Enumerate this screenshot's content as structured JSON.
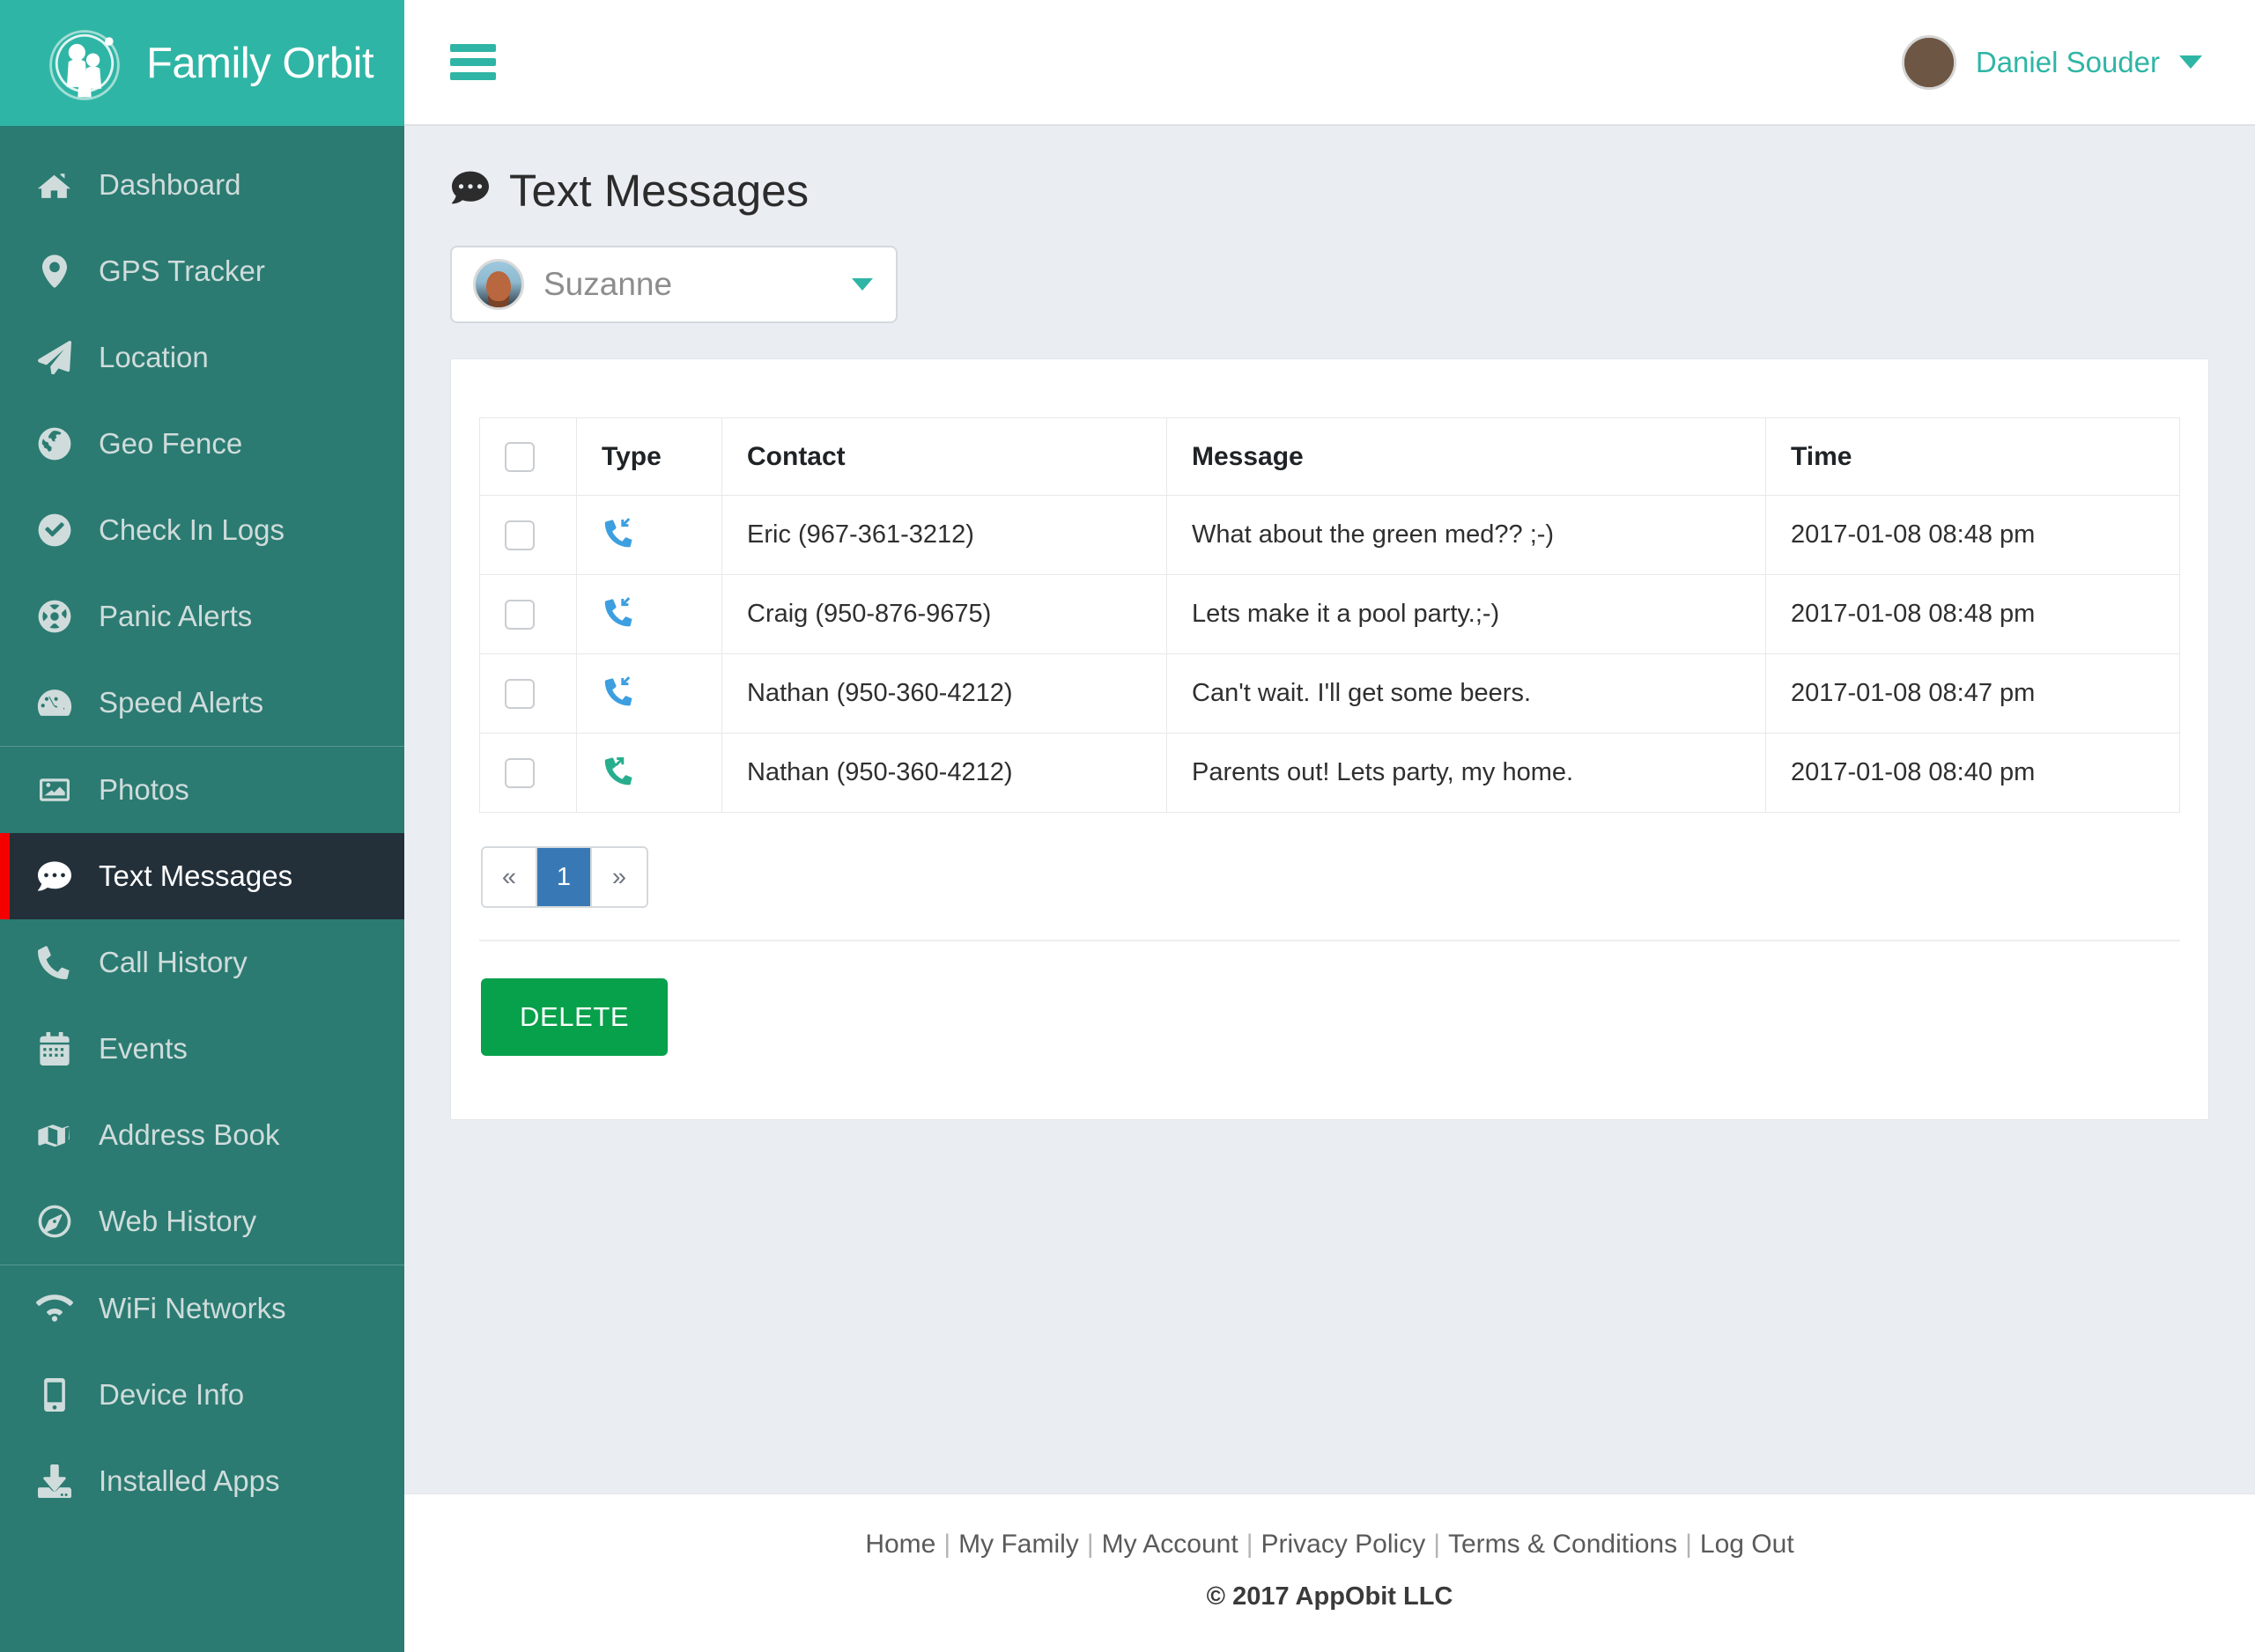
{
  "brand": {
    "name": "Family Orbit",
    "logo_icon": "family-orbit-logo"
  },
  "topbar": {
    "menu_toggle_icon": "hamburger-icon",
    "user_name": "Daniel Souder",
    "user_avatar_icon": "user-avatar",
    "user_caret_icon": "chevron-down-icon"
  },
  "sidebar": {
    "items": [
      {
        "label": "Dashboard",
        "icon": "home-icon",
        "active": false,
        "divider_after": false
      },
      {
        "label": "GPS Tracker",
        "icon": "map-pin-icon",
        "active": false,
        "divider_after": false
      },
      {
        "label": "Location",
        "icon": "paper-plane-icon",
        "active": false,
        "divider_after": false
      },
      {
        "label": "Geo Fence",
        "icon": "globe-icon",
        "active": false,
        "divider_after": false
      },
      {
        "label": "Check In Logs",
        "icon": "check-circle-icon",
        "active": false,
        "divider_after": false
      },
      {
        "label": "Panic Alerts",
        "icon": "life-ring-icon",
        "active": false,
        "divider_after": false
      },
      {
        "label": "Speed Alerts",
        "icon": "tachometer-icon",
        "active": false,
        "divider_after": true
      },
      {
        "label": "Photos",
        "icon": "image-icon",
        "active": false,
        "divider_after": false
      },
      {
        "label": "Text Messages",
        "icon": "comment-dots-icon",
        "active": true,
        "divider_after": false
      },
      {
        "label": "Call History",
        "icon": "phone-icon",
        "active": false,
        "divider_after": false
      },
      {
        "label": "Events",
        "icon": "calendar-icon",
        "active": false,
        "divider_after": false
      },
      {
        "label": "Address Book",
        "icon": "book-icon",
        "active": false,
        "divider_after": false
      },
      {
        "label": "Web History",
        "icon": "compass-icon",
        "active": false,
        "divider_after": true
      },
      {
        "label": "WiFi Networks",
        "icon": "wifi-icon",
        "active": false,
        "divider_after": false
      },
      {
        "label": "Device Info",
        "icon": "mobile-icon",
        "active": false,
        "divider_after": false
      },
      {
        "label": "Installed Apps",
        "icon": "download-icon",
        "active": false,
        "divider_after": false
      }
    ]
  },
  "page": {
    "title": "Text Messages",
    "title_icon": "comment-dots-icon"
  },
  "child_selector": {
    "selected": "Suzanne",
    "avatar_icon": "child-avatar",
    "caret_icon": "caret-down-icon"
  },
  "table": {
    "select_all_icon": "checkbox-unchecked",
    "columns": [
      "",
      "Type",
      "Contact",
      "Message",
      "Time"
    ],
    "rows": [
      {
        "checkbox_icon": "checkbox-unchecked",
        "type": "incoming",
        "type_icon": "phone-incoming-icon",
        "contact": "Eric (967-361-3212)",
        "message": "What about the green med?? ;-)",
        "time": "2017-01-08 08:48 pm"
      },
      {
        "checkbox_icon": "checkbox-unchecked",
        "type": "incoming",
        "type_icon": "phone-incoming-icon",
        "contact": "Craig (950-876-9675)",
        "message": "Lets make it a pool party.;-)",
        "time": "2017-01-08 08:48 pm"
      },
      {
        "checkbox_icon": "checkbox-unchecked",
        "type": "incoming",
        "type_icon": "phone-incoming-icon",
        "contact": "Nathan (950-360-4212)",
        "message": "Can't wait. I'll get some beers.",
        "time": "2017-01-08 08:47 pm"
      },
      {
        "checkbox_icon": "checkbox-unchecked",
        "type": "outgoing",
        "type_icon": "phone-outgoing-icon",
        "contact": "Nathan (950-360-4212)",
        "message": "Parents out! Lets party, my home.",
        "time": "2017-01-08 08:40 pm"
      }
    ]
  },
  "pagination": {
    "prev_label": "«",
    "pages": [
      "1"
    ],
    "current_page": "1",
    "next_label": "»"
  },
  "actions": {
    "delete_label": "DELETE"
  },
  "footer": {
    "links": [
      "Home",
      "My Family",
      "My Account",
      "Privacy Policy",
      "Terms & Conditions",
      "Log Out"
    ],
    "separator": "|",
    "copyright": "© 2017 AppObit LLC"
  },
  "colors": {
    "brand_teal": "#2fb5a5",
    "sidebar_teal": "#2b7b72",
    "active_dark": "#23303a",
    "active_marker_red": "#f40000",
    "incoming_blue": "#3d9fe0",
    "outgoing_green": "#27ae8e",
    "pager_active_blue": "#3879b5",
    "delete_green": "#07a04b",
    "page_bg": "#eaeef2"
  }
}
